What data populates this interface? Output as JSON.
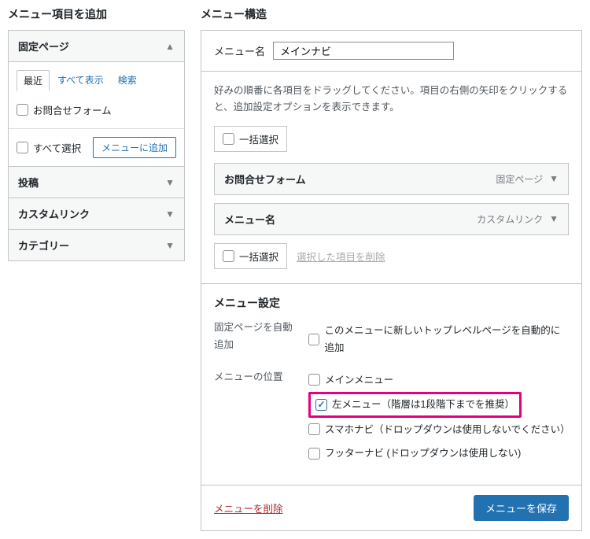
{
  "left": {
    "title": "メニュー項目を追加",
    "pages": {
      "label": "固定ページ",
      "tabs": {
        "recent": "最近",
        "all": "すべて表示",
        "search": "検索"
      },
      "items": [
        {
          "label": "お問合せフォーム"
        }
      ],
      "select_all": "すべて選択",
      "add_btn": "メニューに追加"
    },
    "posts": "投稿",
    "custom": "カスタムリンク",
    "category": "カテゴリー"
  },
  "right": {
    "title": "メニュー構造",
    "name_label": "メニュー名",
    "name_value": "メインナビ",
    "help": "好みの順番に各項目をドラッグしてください。項目の右側の矢印をクリックすると、追加設定オプションを表示できます。",
    "bulk_select": "一括選択",
    "remove_selected": "選択した項目を削除",
    "items": [
      {
        "title": "お問合せフォーム",
        "type": "固定ページ"
      },
      {
        "title": "メニュー名",
        "type": "カスタムリンク"
      }
    ],
    "settings": {
      "title": "メニュー設定",
      "auto_add_label": "固定ページを自動追加",
      "auto_add_desc": "このメニューに新しいトップレベルページを自動的に追加",
      "location_label": "メニューの位置",
      "locations": {
        "main": "メインメニュー",
        "left": "左メニュー（階層は1段階下までを推奨）",
        "sp": "スマホナビ（ドロップダウンは使用しないでください）",
        "footer": "フッターナビ (ドロップダウンは使用しない)"
      }
    },
    "delete": "メニューを削除",
    "save": "メニューを保存"
  }
}
